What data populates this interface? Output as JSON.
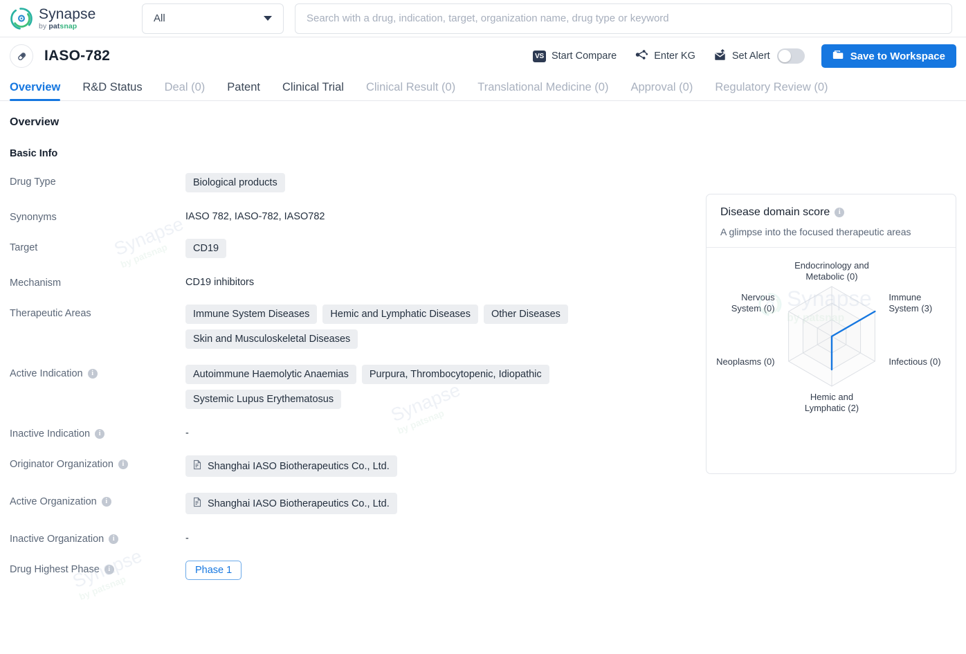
{
  "brand": {
    "name": "Synapse",
    "tagline_prefix": "by ",
    "tagline_a": "pat",
    "tagline_b": "snap"
  },
  "search": {
    "scope_value": "All",
    "placeholder": "Search with a drug, indication, target, organization name, drug type or keyword",
    "value": ""
  },
  "drug": {
    "title": "IASO-782"
  },
  "actions": {
    "start_compare": "Start Compare",
    "vs_label": "VS",
    "enter_kg": "Enter KG",
    "set_alert": "Set Alert",
    "alert_enabled": false,
    "save_to_workspace": "Save to Workspace",
    "accent_color": "#1677e0"
  },
  "tabs": [
    {
      "label": "Overview",
      "state": "active"
    },
    {
      "label": "R&D Status",
      "state": "normal"
    },
    {
      "label": "Deal (0)",
      "state": "muted"
    },
    {
      "label": "Patent",
      "state": "normal"
    },
    {
      "label": "Clinical Trial",
      "state": "normal"
    },
    {
      "label": "Clinical Result (0)",
      "state": "muted"
    },
    {
      "label": "Translational Medicine (0)",
      "state": "muted"
    },
    {
      "label": "Approval (0)",
      "state": "muted"
    },
    {
      "label": "Regulatory Review (0)",
      "state": "muted"
    }
  ],
  "overview": {
    "heading": "Overview",
    "basic_info_heading": "Basic Info",
    "rows": [
      {
        "label": "Drug Type",
        "has_info": false,
        "type": "chips",
        "values": [
          "Biological products"
        ]
      },
      {
        "label": "Synonyms",
        "has_info": false,
        "type": "text",
        "text": "IASO 782,  IASO-782,  IASO782"
      },
      {
        "label": "Target",
        "has_info": false,
        "type": "chips",
        "values": [
          "CD19"
        ]
      },
      {
        "label": "Mechanism",
        "has_info": false,
        "type": "text",
        "text": "CD19 inhibitors"
      },
      {
        "label": "Therapeutic Areas",
        "has_info": false,
        "type": "chips",
        "values": [
          "Immune System Diseases",
          "Hemic and Lymphatic Diseases",
          "Other Diseases",
          "Skin and Musculoskeletal Diseases"
        ]
      },
      {
        "label": "Active Indication",
        "has_info": true,
        "type": "chips",
        "values": [
          "Autoimmune Haemolytic Anaemias",
          "Purpura, Thrombocytopenic, Idiopathic",
          "Systemic Lupus Erythematosus"
        ]
      },
      {
        "label": "Inactive Indication",
        "has_info": true,
        "type": "text",
        "text": "-"
      },
      {
        "label": "Originator Organization",
        "has_info": true,
        "type": "org_chips",
        "values": [
          "Shanghai IASO Biotherapeutics Co., Ltd."
        ]
      },
      {
        "label": "Active Organization",
        "has_info": true,
        "type": "org_chips",
        "values": [
          "Shanghai IASO Biotherapeutics Co., Ltd."
        ]
      },
      {
        "label": "Inactive Organization",
        "has_info": true,
        "type": "text",
        "text": "-"
      },
      {
        "label": "Drug Highest Phase",
        "has_info": true,
        "type": "phase",
        "values": [
          "Phase 1"
        ]
      }
    ]
  },
  "score_card": {
    "title": "Disease domain score",
    "subtitle": "A glimpse into the focused therapeutic areas"
  },
  "chart_data": {
    "type": "radar",
    "title": "Disease domain score",
    "subtitle": "A glimpse into the focused therapeutic areas",
    "categories": [
      "Endocrinology and Metabolic",
      "Immune System",
      "Infectious",
      "Hemic and Lymphatic",
      "Neoplasms",
      "Nervous System"
    ],
    "labels": [
      "Endocrinology and\nMetabolic (0)",
      "Immune\nSystem (3)",
      "Infectious (0)",
      "Hemic and\nLymphatic (2)",
      "Neoplasms (0)",
      "Nervous\nSystem (0)"
    ],
    "values": [
      0,
      3,
      0,
      2,
      0,
      0
    ],
    "rings": 3,
    "max": 3,
    "grid": true,
    "series_color": "#1677e0",
    "grid_color": "#dcdfe4",
    "legend": false
  },
  "watermark": {
    "title": "Synapse",
    "sub": "by patsnap"
  }
}
